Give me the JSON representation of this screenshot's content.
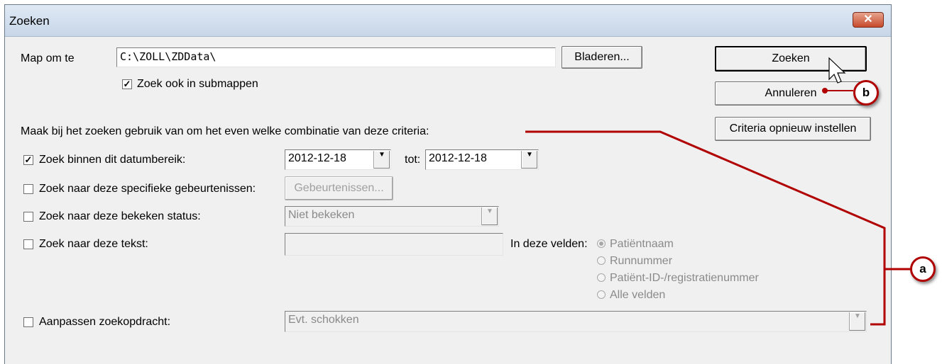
{
  "window": {
    "title": "Zoeken",
    "close_icon": "close-icon"
  },
  "folder": {
    "label": "Map om te",
    "path": "C:\\ZOLL\\ZDData\\",
    "browse_label": "Bladeren...",
    "subfolders_label": "Zoek ook in submappen",
    "subfolders_checked": true
  },
  "actions": {
    "search_label": "Zoeken",
    "cancel_label": "Annuleren",
    "reset_label": "Criteria opnieuw instellen"
  },
  "criteria": {
    "intro": "Maak bij het zoeken gebruik van om het even welke combinatie van deze criteria:",
    "date_range": {
      "label": "Zoek binnen dit datumbereik:",
      "checked": true,
      "from": "2012-12-18",
      "to_label": "tot:",
      "to": "2012-12-18"
    },
    "events": {
      "label": "Zoek naar deze specifieke gebeurtenissen:",
      "checked": false,
      "button_label": "Gebeurtenissen..."
    },
    "status": {
      "label": "Zoek naar deze bekeken status:",
      "checked": false,
      "value": "Niet bekeken"
    },
    "text": {
      "label": "Zoek naar deze tekst:",
      "checked": false,
      "value": "",
      "fields_label": "In deze velden:",
      "options": [
        "Patiëntnaam",
        "Runnummer",
        "Patiënt-ID-/registratienummer",
        "Alle velden"
      ],
      "selected_index": 0
    },
    "custom": {
      "label": "Aanpassen zoekopdracht:",
      "checked": false,
      "value": "Evt. schokken"
    }
  },
  "annotations": {
    "a": "a",
    "b": "b",
    "color": "#b00000"
  },
  "colors": {
    "dialog_bg": "#f0f0f0",
    "title_gradient_top": "#dfe9f5",
    "close_red": "#c64a2c"
  }
}
